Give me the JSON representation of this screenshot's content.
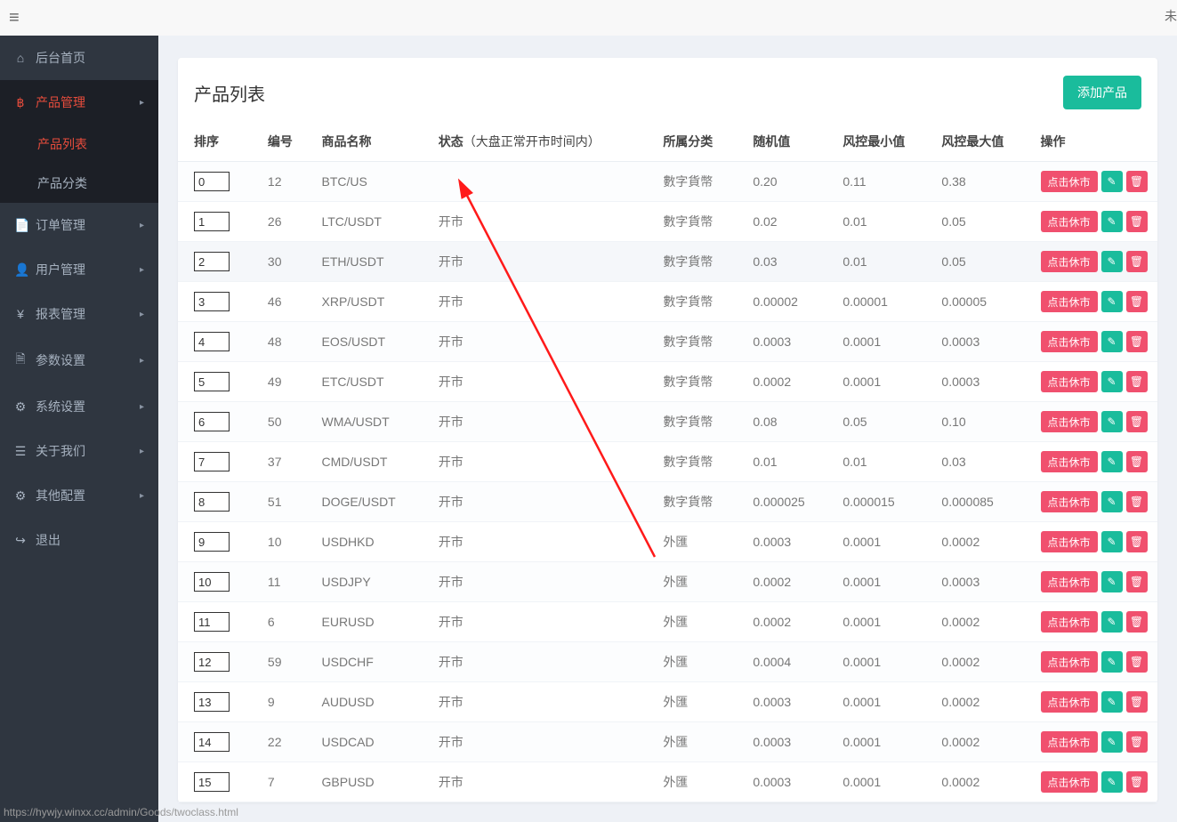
{
  "top": {
    "hamburger": "≡",
    "right_fragment": "未",
    "status_url": "https://hywjy.winxx.cc/admin/Goods/twoclass.html"
  },
  "sidebar": {
    "items": [
      {
        "icon": "⌂",
        "label": "后台首页",
        "expandable": false
      },
      {
        "icon": "฿",
        "label": "产品管理",
        "expandable": true,
        "active": true,
        "children": [
          {
            "label": "产品列表",
            "active": true
          },
          {
            "label": "产品分类",
            "active": false
          }
        ]
      },
      {
        "icon": "📄",
        "label": "订单管理",
        "expandable": true
      },
      {
        "icon": "👤",
        "label": "用户管理",
        "expandable": true
      },
      {
        "icon": "¥",
        "label": "报表管理",
        "expandable": true
      },
      {
        "icon": "🗎",
        "label": "参数设置",
        "expandable": true
      },
      {
        "icon": "⚙",
        "label": "系统设置",
        "expandable": true
      },
      {
        "icon": "☰",
        "label": "关于我们",
        "expandable": true
      },
      {
        "icon": "⚙",
        "label": "其他配置",
        "expandable": true
      },
      {
        "icon": "↪",
        "label": "退出",
        "expandable": false
      }
    ]
  },
  "page": {
    "title": "产品列表",
    "add_button": "添加产品",
    "columns": {
      "sort": "排序",
      "no": "编号",
      "name": "商品名称",
      "status": "状态",
      "status_hint": "（大盘正常开市时间内）",
      "category": "所属分类",
      "rand": "随机值",
      "min": "风控最小值",
      "max": "风控最大值",
      "op": "操作"
    },
    "op_labels": {
      "toggle": "点击休市",
      "edit_icon": "✎",
      "delete_icon": "🗑"
    },
    "rows": [
      {
        "sort": "0",
        "no": "12",
        "name": "BTC/US",
        "status": "",
        "category": "數字貨幣",
        "rand": "0.20",
        "min": "0.11",
        "max": "0.38"
      },
      {
        "sort": "1",
        "no": "26",
        "name": "LTC/USDT",
        "status": "开市",
        "category": "數字貨幣",
        "rand": "0.02",
        "min": "0.01",
        "max": "0.05"
      },
      {
        "sort": "2",
        "no": "30",
        "name": "ETH/USDT",
        "status": "开市",
        "category": "數字貨幣",
        "rand": "0.03",
        "min": "0.01",
        "max": "0.05"
      },
      {
        "sort": "3",
        "no": "46",
        "name": "XRP/USDT",
        "status": "开市",
        "category": "數字貨幣",
        "rand": "0.00002",
        "min": "0.00001",
        "max": "0.00005"
      },
      {
        "sort": "4",
        "no": "48",
        "name": "EOS/USDT",
        "status": "开市",
        "category": "數字貨幣",
        "rand": "0.0003",
        "min": "0.0001",
        "max": "0.0003"
      },
      {
        "sort": "5",
        "no": "49",
        "name": "ETC/USDT",
        "status": "开市",
        "category": "數字貨幣",
        "rand": "0.0002",
        "min": "0.0001",
        "max": "0.0003"
      },
      {
        "sort": "6",
        "no": "50",
        "name": "WMA/USDT",
        "status": "开市",
        "category": "數字貨幣",
        "rand": "0.08",
        "min": "0.05",
        "max": "0.10"
      },
      {
        "sort": "7",
        "no": "37",
        "name": "CMD/USDT",
        "status": "开市",
        "category": "數字貨幣",
        "rand": "0.01",
        "min": "0.01",
        "max": "0.03"
      },
      {
        "sort": "8",
        "no": "51",
        "name": "DOGE/USDT",
        "status": "开市",
        "category": "數字貨幣",
        "rand": "0.000025",
        "min": "0.000015",
        "max": "0.000085"
      },
      {
        "sort": "9",
        "no": "10",
        "name": "USDHKD",
        "status": "开市",
        "category": "外匯",
        "rand": "0.0003",
        "min": "0.0001",
        "max": "0.0002"
      },
      {
        "sort": "10",
        "no": "11",
        "name": "USDJPY",
        "status": "开市",
        "category": "外匯",
        "rand": "0.0002",
        "min": "0.0001",
        "max": "0.0003"
      },
      {
        "sort": "11",
        "no": "6",
        "name": "EURUSD",
        "status": "开市",
        "category": "外匯",
        "rand": "0.0002",
        "min": "0.0001",
        "max": "0.0002"
      },
      {
        "sort": "12",
        "no": "59",
        "name": "USDCHF",
        "status": "开市",
        "category": "外匯",
        "rand": "0.0004",
        "min": "0.0001",
        "max": "0.0002"
      },
      {
        "sort": "13",
        "no": "9",
        "name": "AUDUSD",
        "status": "开市",
        "category": "外匯",
        "rand": "0.0003",
        "min": "0.0001",
        "max": "0.0002"
      },
      {
        "sort": "14",
        "no": "22",
        "name": "USDCAD",
        "status": "开市",
        "category": "外匯",
        "rand": "0.0003",
        "min": "0.0001",
        "max": "0.0002"
      },
      {
        "sort": "15",
        "no": "7",
        "name": "GBPUSD",
        "status": "开市",
        "category": "外匯",
        "rand": "0.0003",
        "min": "0.0001",
        "max": "0.0002"
      }
    ]
  }
}
